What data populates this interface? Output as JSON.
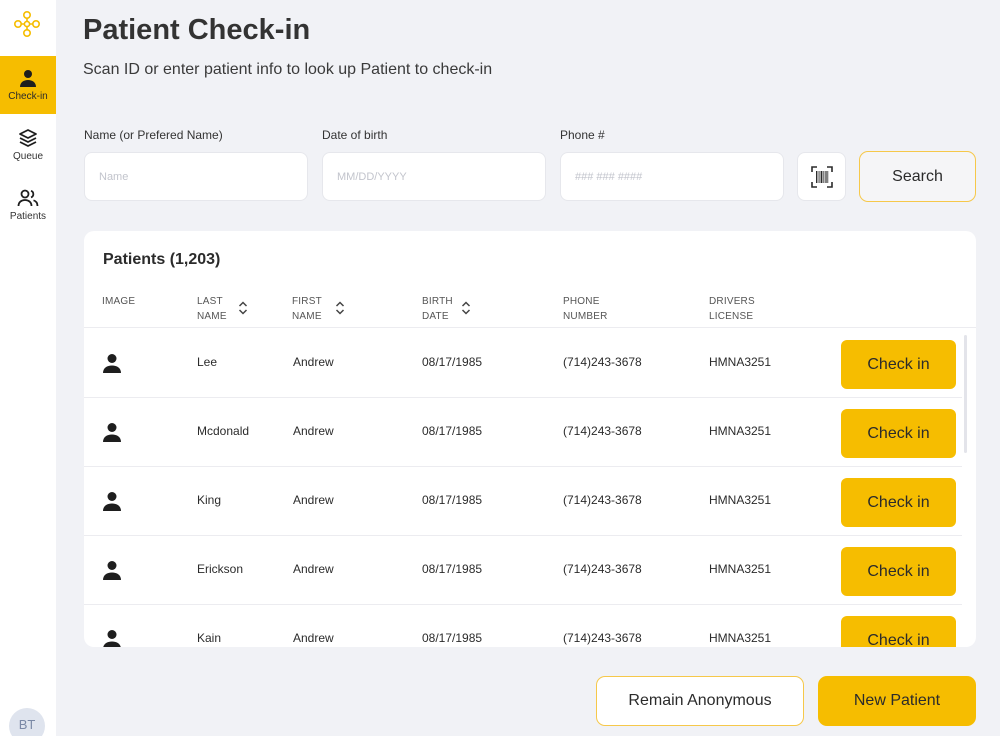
{
  "colors": {
    "accent": "#f6bd00",
    "background": "#f1f2f6",
    "surface": "#ffffff"
  },
  "sidebar": {
    "logo_icon": "clinic-logo-icon",
    "items": [
      {
        "label": "Check-in",
        "icon": "person-icon",
        "active": true
      },
      {
        "label": "Queue",
        "icon": "layers-icon",
        "active": false
      },
      {
        "label": "Patients",
        "icon": "people-icon",
        "active": false
      }
    ],
    "avatar_initials": "BT"
  },
  "header": {
    "title": "Patient Check-in",
    "subtitle": "Scan ID or enter patient info to look up Patient to check-in"
  },
  "search": {
    "name_label": "Name (or Prefered Name)",
    "name_placeholder": "Name",
    "name_value": "",
    "dob_label": "Date of birth",
    "dob_placeholder": "MM/DD/YYYY",
    "dob_value": "",
    "phone_label": "Phone #",
    "phone_placeholder": "### ### ####",
    "phone_value": "",
    "scan_icon": "barcode-scan-icon",
    "search_label": "Search"
  },
  "patients": {
    "title": "Patients (1,203)",
    "columns": {
      "image": "IMAGE",
      "last_name": "LAST NAME",
      "first_name": "FIRST NAME",
      "birth_date": "BIRTH DATE",
      "phone": "PHONE NUMBER",
      "license": "DRIVERS LICENSE"
    },
    "sortable_icon": "sort-icon",
    "rows": [
      {
        "last": "Lee",
        "first": "Andrew",
        "dob": "08/17/1985",
        "phone": "(714)243-3678",
        "license": "HMNA3251",
        "action": "Check in"
      },
      {
        "last": "Mcdonald",
        "first": "Andrew",
        "dob": "08/17/1985",
        "phone": "(714)243-3678",
        "license": "HMNA3251",
        "action": "Check in"
      },
      {
        "last": "King",
        "first": "Andrew",
        "dob": "08/17/1985",
        "phone": "(714)243-3678",
        "license": "HMNA3251",
        "action": "Check in"
      },
      {
        "last": "Erickson",
        "first": "Andrew",
        "dob": "08/17/1985",
        "phone": "(714)243-3678",
        "license": "HMNA3251",
        "action": "Check in"
      },
      {
        "last": "Kain",
        "first": "Andrew",
        "dob": "08/17/1985",
        "phone": "(714)243-3678",
        "license": "HMNA3251",
        "action": "Check in"
      }
    ]
  },
  "footer": {
    "anonymous_label": "Remain Anonymous",
    "new_patient_label": "New Patient"
  }
}
